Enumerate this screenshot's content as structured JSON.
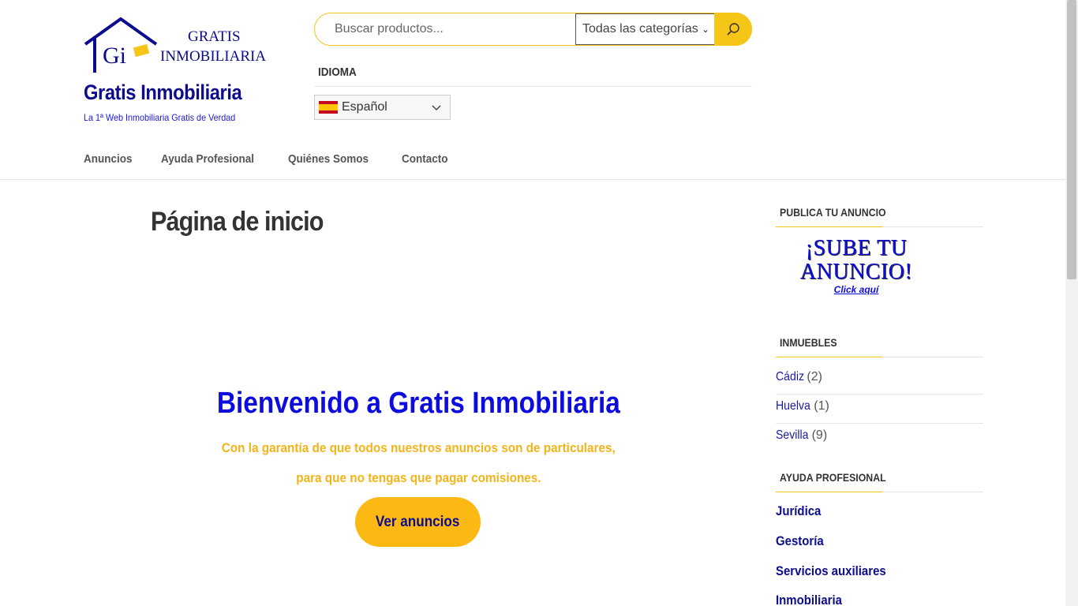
{
  "header": {
    "logo_text_line1": "GRATIS",
    "logo_text_line2": "INMOBILIARIA",
    "logo_initials": "Gi",
    "site_title": "Gratis Inmobiliaria",
    "tagline": "La 1ª Web Inmobiliaria Gratis de Verdad",
    "search": {
      "placeholder": "Buscar productos...",
      "category_selected": "Todas las categorías",
      "button_icon": "search-icon"
    },
    "language": {
      "title": "IDIOMA",
      "selected": "Español",
      "flag": "spain-flag-icon"
    },
    "nav": [
      "Anuncios",
      "Ayuda Profesional",
      "Quiénes Somos",
      "Contacto"
    ]
  },
  "main": {
    "page_title": "Página de inicio",
    "hero": {
      "heading": "Bienvenido a Gratis Inmobiliaria",
      "line1": "Con la garantía de que todos nuestros anuncios son de particulares,",
      "line2": "para que no tengas que pagar comisiones.",
      "cta": "Ver anuncios"
    }
  },
  "sidebar": {
    "publish": {
      "title": "PUBLICA TU ANUNCIO",
      "banner_line1": "¡SUBE TU",
      "banner_line2": "ANUNCIO!",
      "banner_link": "Click aquí"
    },
    "inmuebles": {
      "title": "INMUEBLES",
      "items": [
        {
          "name": "Cádiz",
          "count": "(2)"
        },
        {
          "name": "Huelva",
          "count": "(1)"
        },
        {
          "name": "Sevilla",
          "count": "(9)"
        }
      ]
    },
    "ayuda": {
      "title": "AYUDA PROFESIONAL",
      "items": [
        "Jurídica",
        "Gestoría",
        "Servicios auxiliares",
        "Inmobiliaria"
      ]
    }
  },
  "colors": {
    "brand_blue": "#0c0c8c",
    "accent_blue": "#0c0cdf",
    "brand_yellow": "#f5c518",
    "cta_yellow": "#fdb913"
  }
}
